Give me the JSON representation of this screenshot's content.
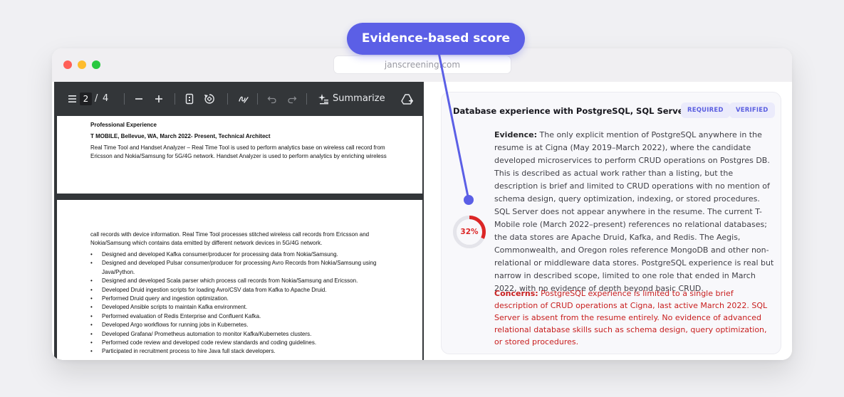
{
  "browser": {
    "url": "janscreening.com"
  },
  "callout": {
    "label": "Evidence-based score"
  },
  "pdf_toolbar": {
    "current_page": "2",
    "page_separator": "/",
    "total_pages": "4",
    "summarize_label": "Summarize"
  },
  "pdf": {
    "page1": {
      "section_heading": "Professional Experience",
      "job_heading": "T MOBILE, Bellevue, WA, March 2022- Present, Technical Architect",
      "line1": "Real Time Tool and Handset Analyzer – Real Time Tool is used to perform analytics base on wireless call record from",
      "line2": "Ericsson and Nokia/Samsung for 5G/4G network. Handset Analyzer is used to perform analytics by enriching wireless"
    },
    "page2": {
      "line1": "call records with device information. Real Time Tool processes stitched wireless call records from Ericsson and",
      "line2": "Nokia/Samsung which contains data emitted by different network devices in 5G/4G network.",
      "bullet_char": "•",
      "bullets": [
        "Designed and developed Kafka consumer/producer for processing data from Nokia/Samsung.",
        "Designed and developed Pulsar consumer/producer for processing Avro Records from Nokia/Samsung using Java/Python.",
        "Designed and developed Scala parser which process call records from Nokia/Samsung and Ericsson.",
        "Developed Druid ingestion scripts for loading Avro/CSV data from Kafka to Apache Druid.",
        "Performed Druid query and ingestion optimization.",
        "Developed Ansible scripts to maintain Kafka environment.",
        "Performed evaluation of Redis Enterprise and Confluent Kafka.",
        "Developed Argo workflows for running jobs in Kubernetes.",
        "Developed Grafana/ Prometheus automation to monitor Kafka/Kubernetes clusters.",
        "Performed code review and developed code review standards and coding guidelines.",
        "Participated in recruitment process to hire Java full stack developers."
      ]
    }
  },
  "card": {
    "title": "Database experience with PostgreSQL, SQL Server",
    "badge_required": "REQUIRED",
    "badge_verified": "VERIFIED",
    "score_label": "32%",
    "score_value": 32,
    "score_color": "#dc2626",
    "evidence_label": "Evidence:",
    "evidence_text": " The only explicit mention of PostgreSQL anywhere in the resume is at Cigna (May 2019–March 2022), where the candidate developed microservices to perform CRUD operations on Postgres DB. This is described as actual work rather than a listing, but the description is brief and limited to CRUD operations with no mention of schema design, query optimization, indexing, or stored procedures. SQL Server does not appear anywhere in the resume. The current T-Mobile role (March 2022–present) references no relational databases; the data stores are Apache Druid, Kafka, and Redis. The Aegis, Commonwealth, and Oregon roles reference MongoDB and other non-relational or middleware data stores. PostgreSQL experience is real but narrow in described scope, limited to one role that ended in March 2022, with no evidence of depth beyond basic CRUD.",
    "concerns_label": "Concerns:",
    "concerns_text": " PostgreSQL experience is limited to a single brief description of CRUD operations at Cigna, last active March 2022. SQL Server is absent from the resume entirely. No evidence of advanced relational database skills such as schema design, query optimization, or stored procedures."
  },
  "colors": {
    "accent": "#5b5fe6",
    "concern": "#c81e1e"
  },
  "icons": [
    "menu-icon",
    "zoom-out-icon",
    "zoom-in-icon",
    "fit-page-icon",
    "rotate-icon",
    "draw-icon",
    "undo-icon",
    "redo-icon",
    "sparkle-icon",
    "add-to-drive-icon"
  ]
}
